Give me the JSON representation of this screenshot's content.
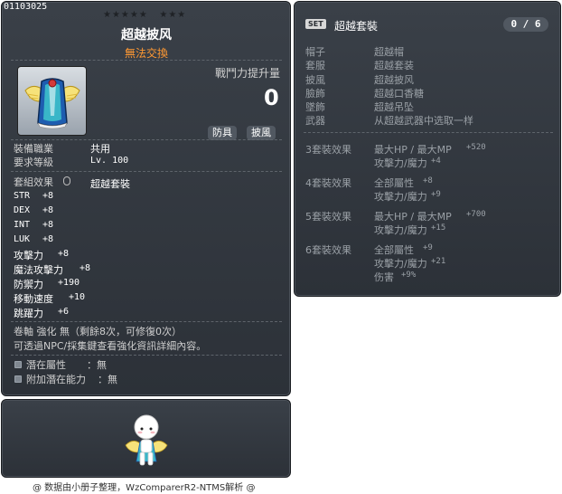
{
  "item": {
    "code": "01103025",
    "stars_left": "★★★★★",
    "stars_right": "★★★",
    "name": "超越披风",
    "trade_note": "無法交換",
    "power_label": "戰鬥力提升量",
    "power_value": "0",
    "tags": [
      "防具",
      "披風"
    ],
    "job_label": "裝備職業",
    "job_value": "共用",
    "level_label": "要求等級",
    "level_value": "Lv. 100",
    "set_label": "套組效果",
    "set_value": "超越套裝",
    "stats": [
      {
        "label": "STR",
        "value": "+8"
      },
      {
        "label": "DEX",
        "value": "+8"
      },
      {
        "label": "INT",
        "value": "+8"
      },
      {
        "label": "LUK",
        "value": "+8"
      },
      {
        "label": "攻擊力",
        "value": "+8"
      },
      {
        "label": "魔法攻擊力",
        "value": "+8"
      },
      {
        "label": "防禦力",
        "value": "+190"
      },
      {
        "label": "移動速度",
        "value": "+10"
      },
      {
        "label": "跳躍力",
        "value": "+6"
      }
    ],
    "scroll_line": "卷軸 強化 無（剩餘8次，可修復0次）",
    "scroll_hint": "可透過NPC/採集鍵查看強化資訊詳細內容。",
    "potential_label": "潛在屬性",
    "potential_value": "：無",
    "bonus_potential_label": "附加潛在能力",
    "bonus_potential_value": "：無"
  },
  "set": {
    "badge": "SET",
    "name": "超越套裝",
    "count": "0 / 6",
    "parts": [
      {
        "slot": "帽子",
        "name": "超越帽"
      },
      {
        "slot": "套服",
        "name": "超越套装"
      },
      {
        "slot": "披風",
        "name": "超越披风"
      },
      {
        "slot": "臉飾",
        "name": "超越口香糖"
      },
      {
        "slot": "墜飾",
        "name": "超越吊坠"
      },
      {
        "slot": "武器",
        "name": "从超越武器中选取一样"
      }
    ],
    "effects": [
      {
        "title": "3套裝效果",
        "lines": [
          {
            "text": "最大HP / 最大MP",
            "num": "+520"
          },
          {
            "text": "攻擊力/魔力",
            "num": "+4"
          }
        ]
      },
      {
        "title": "4套裝效果",
        "lines": [
          {
            "text": "全部屬性",
            "num": "+8"
          },
          {
            "text": "攻擊力/魔力",
            "num": "+9"
          }
        ]
      },
      {
        "title": "5套裝效果",
        "lines": [
          {
            "text": "最大HP / 最大MP",
            "num": "+700"
          },
          {
            "text": "攻擊力/魔力",
            "num": "+15"
          }
        ]
      },
      {
        "title": "6套裝效果",
        "lines": [
          {
            "text": "全部屬性",
            "num": "+9"
          },
          {
            "text": "攻擊力/魔力",
            "num": "+21"
          },
          {
            "text": "伤害",
            "num": "+9%"
          }
        ]
      }
    ]
  },
  "footer": "@ 数据由小册子整理，WzComparerR2-NTMS解析 @",
  "icons": [
    "cape-icon",
    "mouse-icon",
    "set-icon",
    "avatar-figure"
  ],
  "colors": {
    "panel": "#2f353c",
    "name": "#ffffff",
    "trade_note": "#ff9933",
    "muted": "#9aa0a6"
  }
}
